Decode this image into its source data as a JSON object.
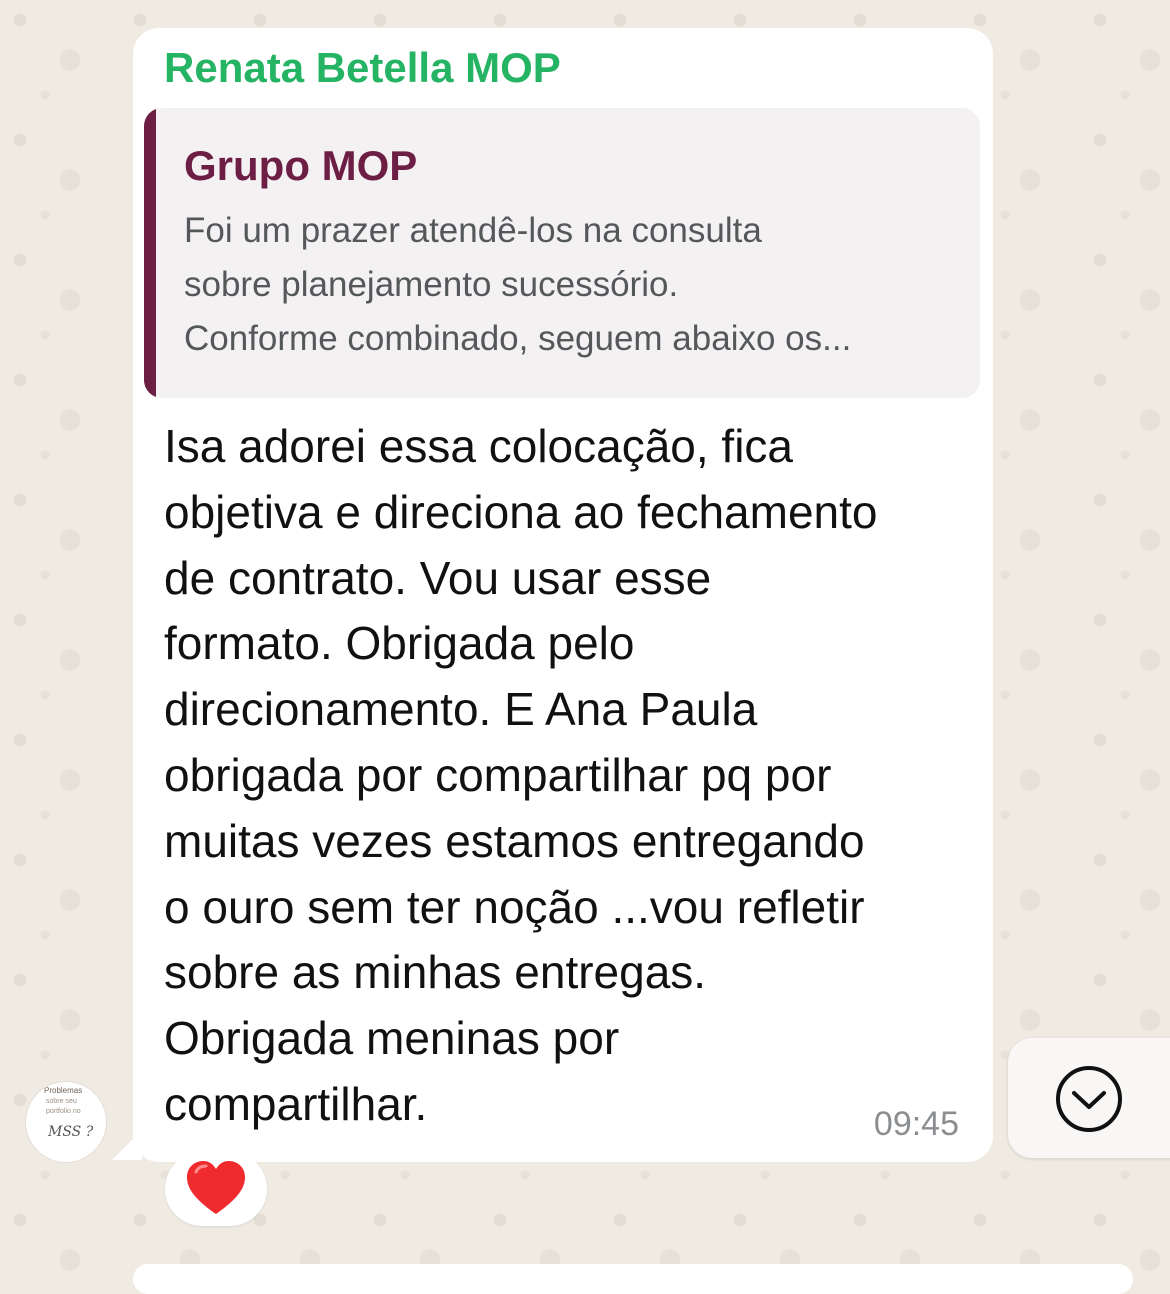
{
  "message": {
    "sender": "Renata Betella MOP",
    "quoted": {
      "title": "Grupo MOP",
      "lines": [
        "Foi um prazer atendê-los na consulta",
        "sobre planejamento sucessório.",
        "Conforme combinado, seguem abaixo os..."
      ]
    },
    "body_lines": [
      "Isa adorei essa colocação, fica",
      "objetiva e direciona ao fechamento",
      "de contrato. Vou usar esse",
      "formato. Obrigada pelo",
      "direcionamento. E Ana Paula",
      "obrigada por compartilhar pq por",
      "muitas vezes estamos entregando",
      "o ouro sem ter noção ...vou refletir",
      "sobre as minhas entregas.",
      "Obrigada meninas por",
      "compartilhar."
    ],
    "time": "09:45",
    "reaction": "❤️"
  },
  "avatar": {
    "text_lines": [
      "Problemas",
      "sobre seu",
      "portfolio no"
    ],
    "mark": "MSS ?"
  },
  "icons": {
    "scroll_down": "chevron-down-circle-icon",
    "reaction": "heart-icon"
  },
  "colors": {
    "sender": "#25b463",
    "quote_accent": "#6d1e44",
    "wallpaper": "#efeae2",
    "bubble": "#ffffff"
  }
}
